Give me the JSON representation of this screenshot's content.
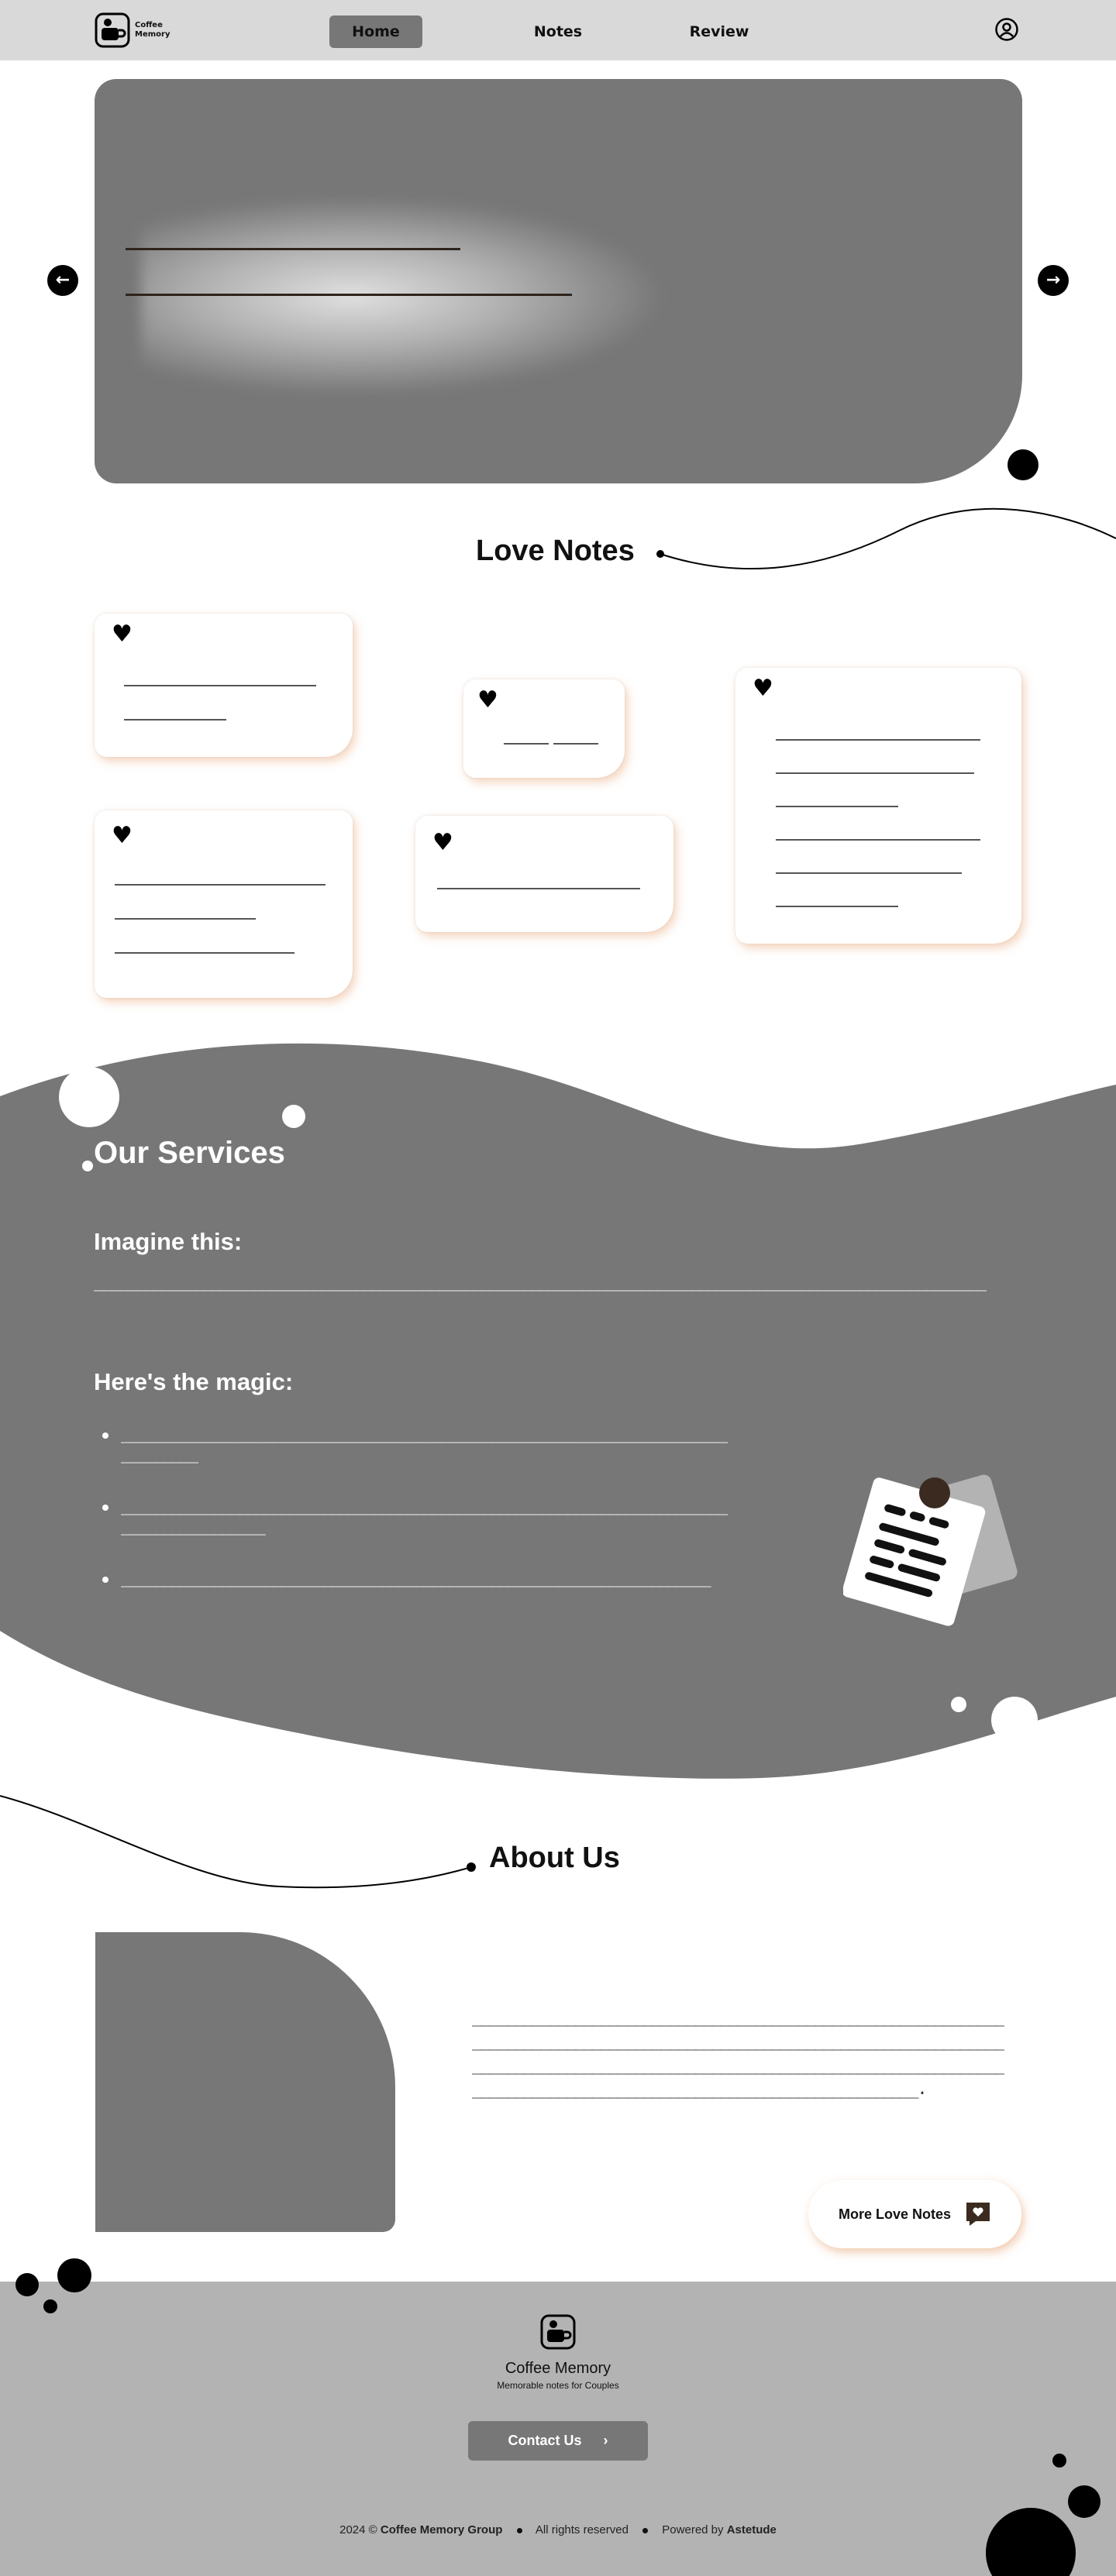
{
  "brand": {
    "name_line1": "Coffee",
    "name_line2": "Memory"
  },
  "nav": {
    "home": "Home",
    "notes": "Notes",
    "review": "Review"
  },
  "notes_section": {
    "title": "Love Notes"
  },
  "services": {
    "title": "Our Services",
    "imagine_heading": "Imagine this:",
    "imagine_text": "__________________________________________________________________________________________________________",
    "magic_heading": "Here's the magic:",
    "bullets": [
      "_________________________________________________________________________________",
      "_________________________________________________________________________________________",
      "______________________________________________________________________"
    ]
  },
  "about": {
    "title": "About Us",
    "text": "______________________________________________________________________________________________________________________________________________________________________________________________________________________________________________.",
    "more_button": "More Love Notes"
  },
  "footer": {
    "name": "Coffee Memory",
    "tagline": "Memorable notes for Couples",
    "contact_button": "Contact Us",
    "contact_chevron": "›",
    "copyright_prefix": "2024 ©",
    "company": "Coffee Memory Group",
    "rights": "All rights reserved",
    "powered_prefix": "Powered by",
    "powered_by": "Astetude"
  },
  "icons": {
    "logo": "coffee-cup-icon",
    "account": "user-circle-icon",
    "prev": "arrow-left-icon",
    "next": "arrow-right-icon",
    "heart": "heart-icon",
    "note": "sticky-note-icon",
    "chat_heart": "heart-chat-icon"
  },
  "colors": {
    "nav_bg": "#d9d9d9",
    "primary_gray": "#777777",
    "footer_bg": "#b3b3b3",
    "accent_brown": "#3b2a20",
    "shadow_peach": "#ebb48c"
  }
}
